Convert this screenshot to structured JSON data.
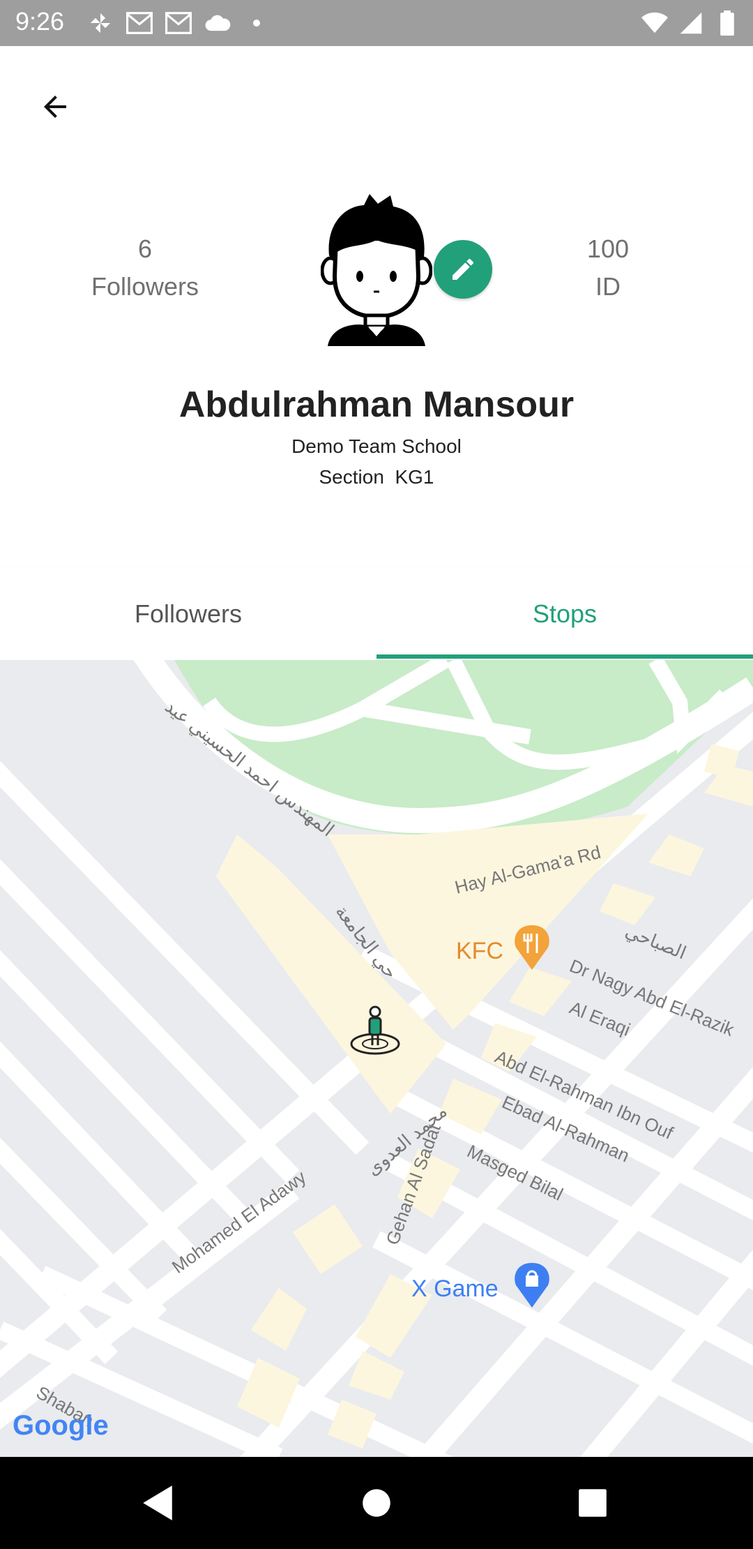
{
  "status_bar": {
    "time": "9:26",
    "left_icons": [
      "pinwheel-icon",
      "gmail-icon",
      "gmail-icon",
      "cloud-icon",
      "dot-icon"
    ],
    "right_icons": [
      "wifi-icon",
      "signal-icon",
      "battery-icon"
    ]
  },
  "header": {
    "followers_count": "6",
    "followers_label": "Followers",
    "id_value": "100",
    "id_label": "ID",
    "name": "Abdulrahman Mansour",
    "school": "Demo Team School",
    "section": "Section  KG1"
  },
  "tabs": [
    {
      "label": "Followers",
      "selected": false
    },
    {
      "label": "Stops",
      "selected": true
    }
  ],
  "map": {
    "labels": {
      "hay_al_gamaa": "Hay Al-Gama'a Rd",
      "kfc": "KFC",
      "dr_nagy": "Dr Nagy Abd El-Razik",
      "al_eraqi": "Al Eraqi",
      "abd_el_rahman": "Abd El-Rahman Ibn Ouf",
      "ebad": "Ebad Al-Rahman",
      "masged": "Masged Bilal",
      "gehan": "Gehan Al Sadat",
      "mohamed": "Mohamed El Adawy",
      "xgame": "X Game",
      "shaban": "Shaban",
      "arabic_engineer": "المهندس احمد الحسيني عيد",
      "arabic_hay": "حي الجامعة",
      "arabic_mohamed": "محمد العدوى",
      "arabic_sabahi": "الصباحي",
      "google": "Google"
    }
  },
  "colors": {
    "accent": "#22a07a",
    "status_bar": "#9e9e9e",
    "map_park": "#c8ebc8",
    "map_block": "#fdf6df",
    "map_poi_orange": "#f2a33a",
    "map_poi_blue": "#3d7ff2"
  },
  "nav_bar": {
    "icons": [
      "back-triangle-icon",
      "home-circle-icon",
      "recents-square-icon"
    ]
  }
}
